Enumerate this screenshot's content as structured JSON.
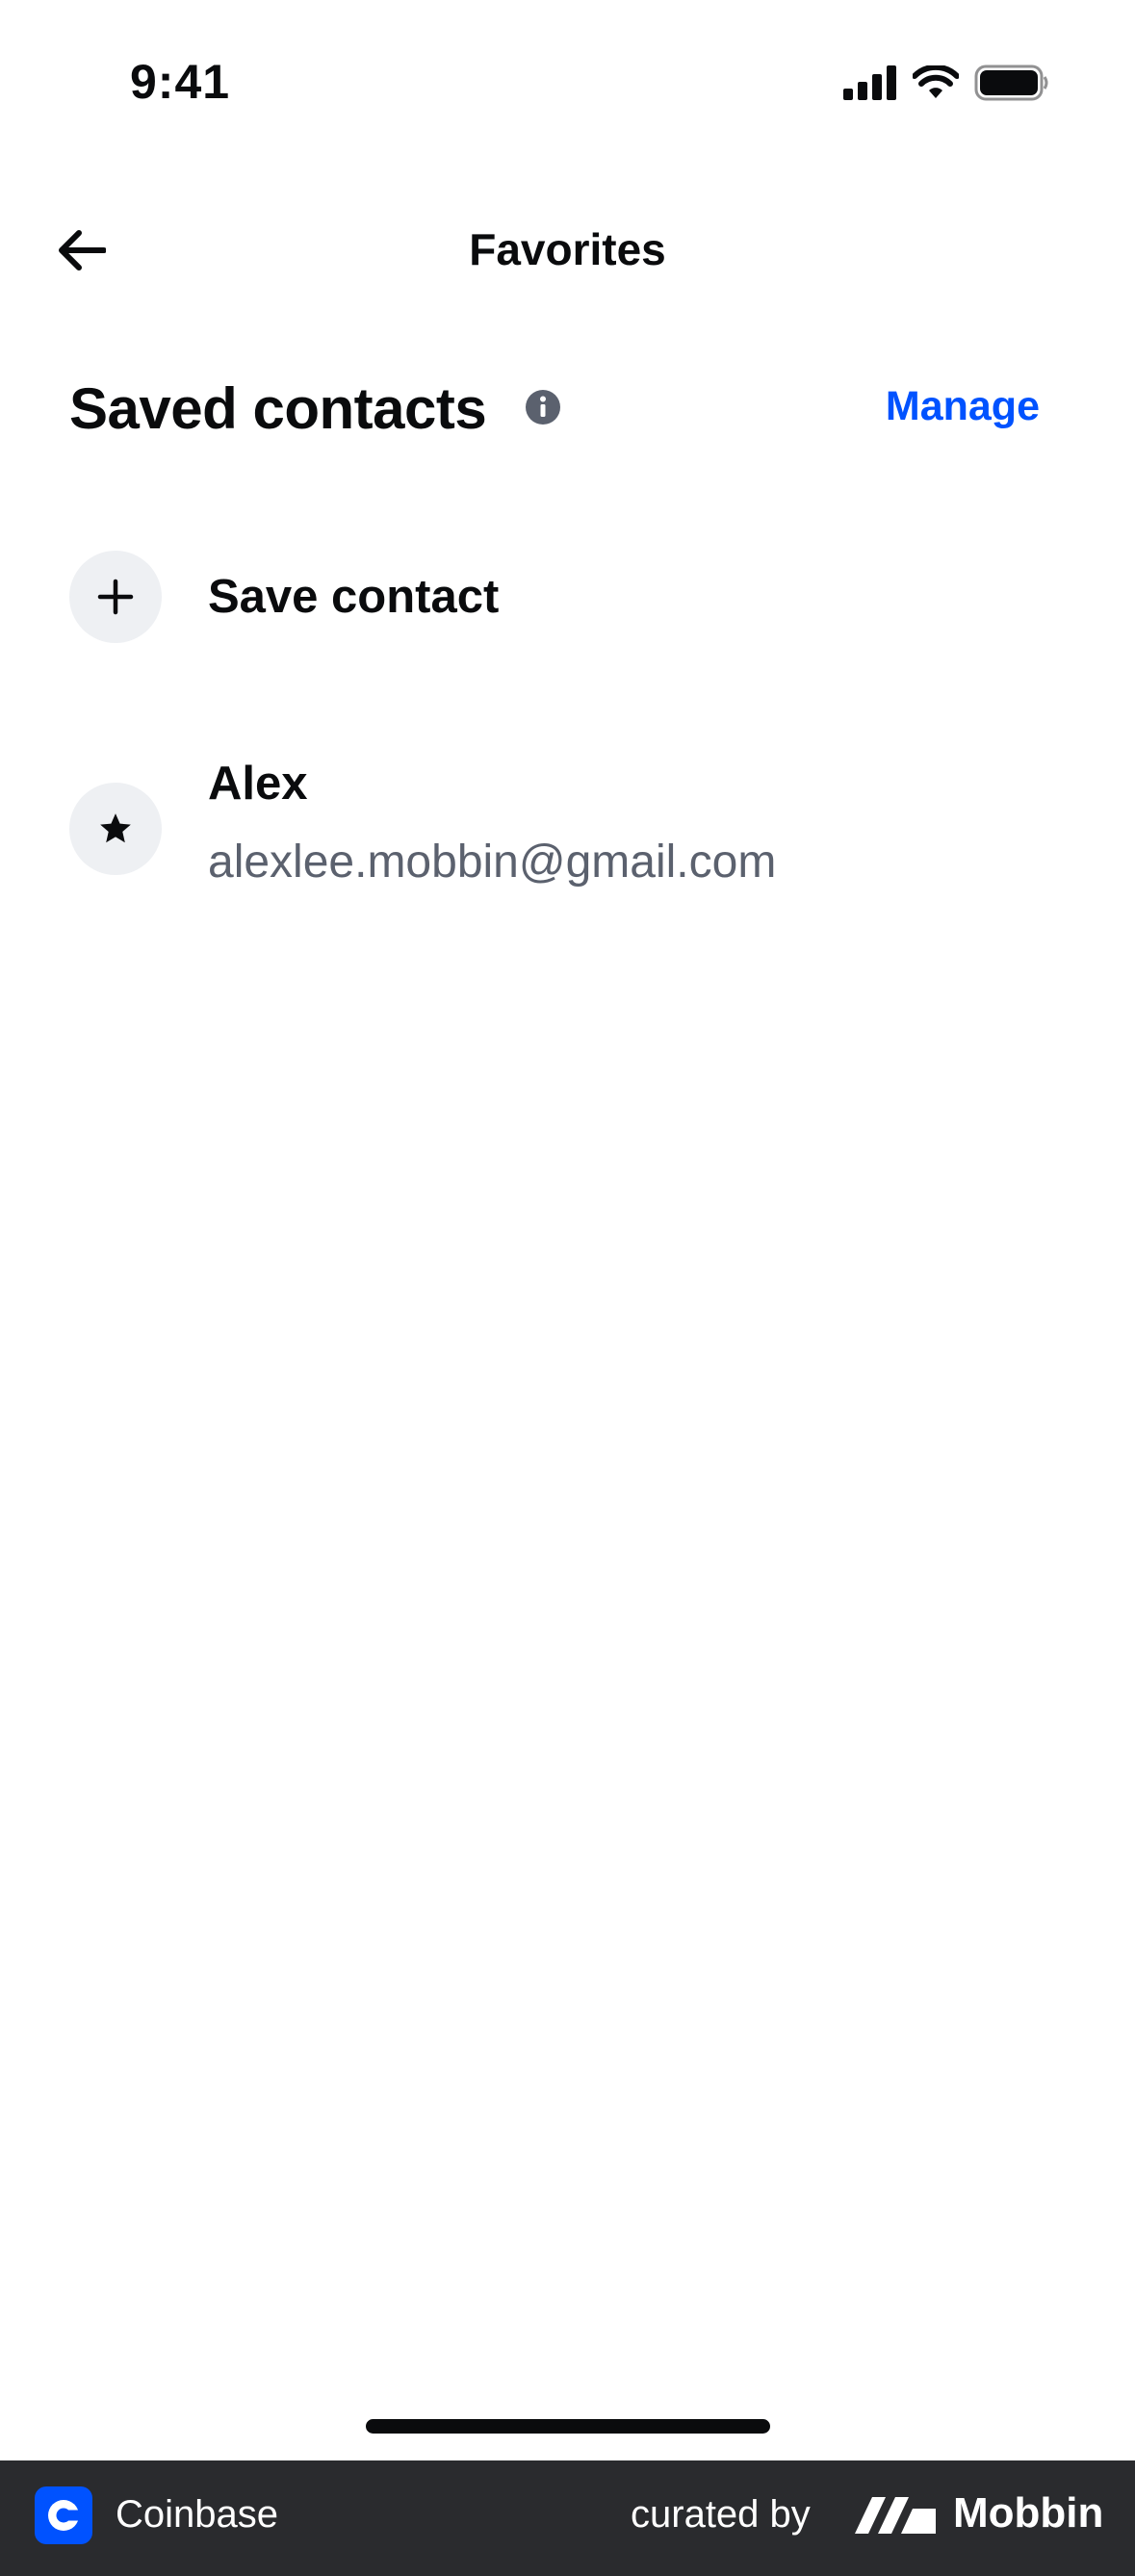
{
  "status_bar": {
    "time": "9:41"
  },
  "nav": {
    "title": "Favorites"
  },
  "section": {
    "title": "Saved contacts",
    "action": "Manage"
  },
  "save_contact": {
    "label": "Save contact"
  },
  "contacts": [
    {
      "name": "Alex",
      "email": "alexlee.mobbin@gmail.com"
    }
  ],
  "footer": {
    "app_name": "Coinbase",
    "curated_by": "curated by",
    "brand": "Mobbin"
  },
  "colors": {
    "accent": "#0052ff",
    "icon_bg": "#eef0f3",
    "secondary_text": "#5b616e",
    "footer_bg": "#2a2b2e"
  }
}
